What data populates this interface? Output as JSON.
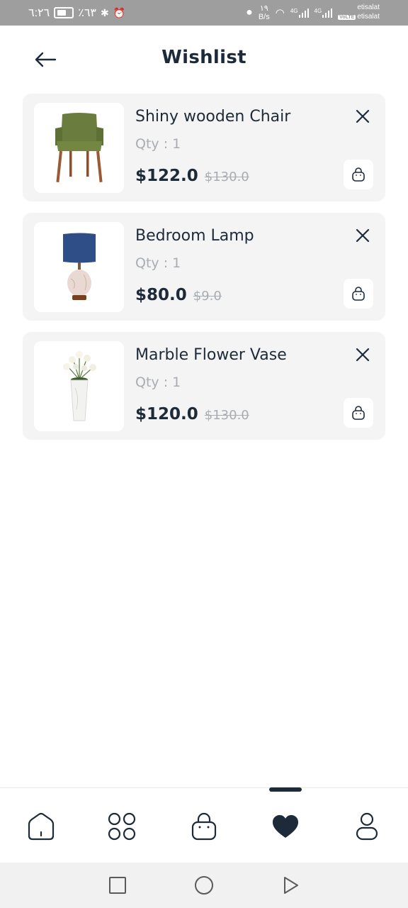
{
  "status_bar": {
    "time": "٦:٢٦",
    "battery": "٪٦٣",
    "speed_value": "١٩",
    "speed_unit": "B/s",
    "network_1": "4G",
    "network_2": "4G",
    "carrier_1": "etisalat",
    "carrier_2": "etisalat",
    "volte": "VoLTE"
  },
  "header": {
    "title": "Wishlist"
  },
  "items": [
    {
      "name": "Shiny wooden Chair",
      "qty": "Qty : 1",
      "price": "$122.0",
      "old_price": "$130.0",
      "image_icon": "chair-image"
    },
    {
      "name": "Bedroom Lamp",
      "qty": "Qty : 1",
      "price": "$80.0",
      "old_price": "$9.0",
      "image_icon": "lamp-image"
    },
    {
      "name": "Marble Flower Vase",
      "qty": "Qty : 1",
      "price": "$120.0",
      "old_price": "$130.0",
      "image_icon": "vase-image"
    }
  ],
  "bottom_nav": {
    "items": [
      "home-icon",
      "categories-icon",
      "cart-icon",
      "heart-icon",
      "profile-icon"
    ],
    "active": "heart-icon"
  },
  "colors": {
    "primary": "#1c2a3a",
    "muted": "#a8adb3",
    "card": "#f4f4f4"
  }
}
